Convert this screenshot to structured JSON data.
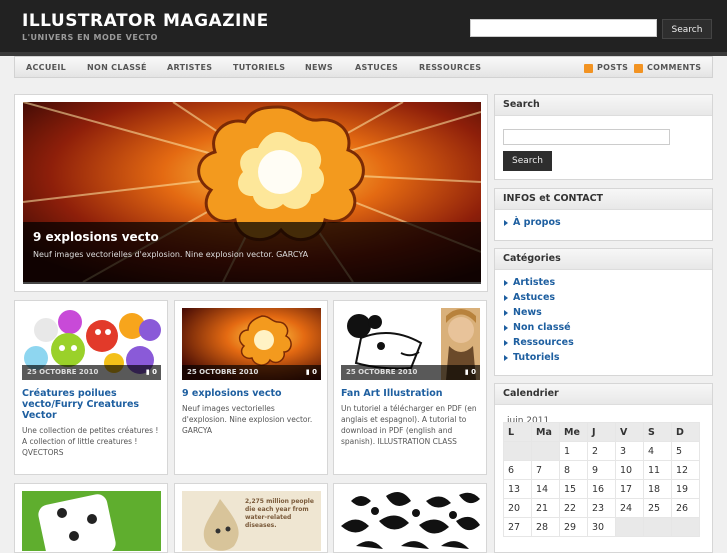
{
  "site": {
    "title": "ILLUSTRATOR MAGAZINE",
    "tagline": "L'UNIVERS EN MODE VECTO",
    "search_button": "Search"
  },
  "nav": {
    "items": [
      "ACCUEIL",
      "NON CLASSÉ",
      "ARTISTES",
      "TUTORIELS",
      "NEWS",
      "ASTUCES",
      "RESSOURCES"
    ],
    "posts": "POSTS",
    "comments": "COMMENTS"
  },
  "featured": {
    "title": "9 explosions vecto",
    "description": "Neuf images vectorielles d'explosion. Nine explosion vector. GARCYA"
  },
  "posts": [
    {
      "date": "25 OCTOBRE 2010",
      "comments": "0",
      "title": "Créatures poilues vecto/Furry Creatures Vector",
      "excerpt": "Une collection de petites créatures ! A collection of little creatures ! QVECTORS"
    },
    {
      "date": "25 OCTOBRE 2010",
      "comments": "0",
      "title": "9 explosions vecto",
      "excerpt": "Neuf images vectorielles d'explosion. Nine explosion vector. GARCYA"
    },
    {
      "date": "25 OCTOBRE 2010",
      "comments": "0",
      "title": "Fan Art Illustration",
      "excerpt": "Un tutoriel a télécharger en PDF (en anglais et espagnol). A tutorial to download in PDF (english and spanish). ILLUSTRATION CLASS"
    }
  ],
  "second_row": {
    "poster_text": "2,275 million people die each year from water-related diseases."
  },
  "sidebar": {
    "search": {
      "title": "Search",
      "button": "Search"
    },
    "infos": {
      "title": "INFOS et CONTACT",
      "items": [
        "À propos"
      ]
    },
    "categories": {
      "title": "Catégories",
      "items": [
        "Artistes",
        "Astuces",
        "News",
        "Non classé",
        "Ressources",
        "Tutoriels"
      ]
    },
    "calendar": {
      "title": "Calendrier",
      "month": "juin 2011",
      "days": [
        "L",
        "Ma",
        "Me",
        "J",
        "V",
        "S",
        "D"
      ],
      "weeks": [
        [
          "",
          "",
          "1",
          "2",
          "3",
          "4",
          "5"
        ],
        [
          "6",
          "7",
          "8",
          "9",
          "10",
          "11",
          "12"
        ],
        [
          "13",
          "14",
          "15",
          "16",
          "17",
          "18",
          "19"
        ],
        [
          "20",
          "21",
          "22",
          "23",
          "24",
          "25",
          "26"
        ],
        [
          "27",
          "28",
          "29",
          "30",
          "",
          "",
          ""
        ]
      ]
    }
  }
}
